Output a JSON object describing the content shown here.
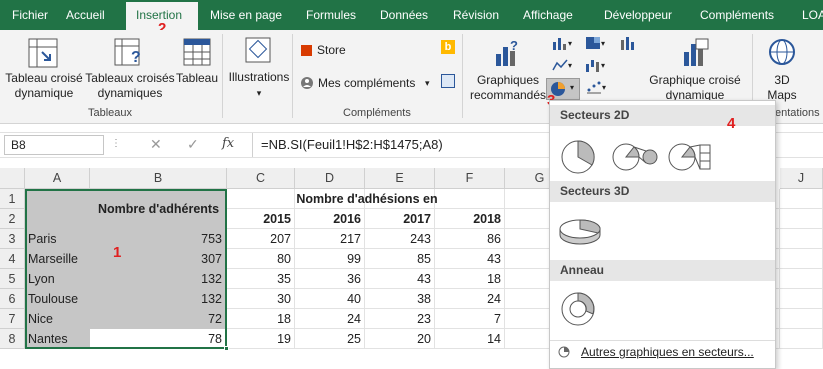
{
  "tabs": [
    "Fichier",
    "Accueil",
    "Insertion",
    "Mise en page",
    "Formules",
    "Données",
    "Révision",
    "Affichage",
    "Développeur",
    "Compléments",
    "LOA"
  ],
  "ribbon": {
    "tableau_croise": "Tableau croisé dynamique",
    "tableaux_croises": "Tableaux croisés dynamiques",
    "tableau": "Tableau",
    "group_tableaux": "Tableaux",
    "illustrations": "Illustrations",
    "store": "Store",
    "mes_complements": "Mes compléments",
    "group_complements": "Compléments",
    "graphiques_recommandes": "Graphiques recommandés",
    "graphique_croise": "Graphique croisé dynamique",
    "maps": "3D Maps",
    "group_visites": "entations"
  },
  "annotations": {
    "n1": "1",
    "n2": "2",
    "n3": "3",
    "n4": "4"
  },
  "formula": {
    "namebox": "B8",
    "fx": "fx",
    "content": "=NB.SI(Feuil1!H$2:H$1475;A8)"
  },
  "columns": [
    "A",
    "B",
    "C",
    "D",
    "E",
    "F",
    "G",
    "J"
  ],
  "rows": [
    "1",
    "2",
    "3",
    "4",
    "5",
    "6",
    "7",
    "8"
  ],
  "sheet": {
    "header_b": "Nombre d'adhérents",
    "title": "Nombre d'adhésions en",
    "years": [
      "2015",
      "2016",
      "2017",
      "2018"
    ],
    "data": [
      {
        "city": "Paris",
        "total": "753",
        "y": [
          "207",
          "217",
          "243",
          "86"
        ]
      },
      {
        "city": "Marseille",
        "total": "307",
        "y": [
          "80",
          "99",
          "85",
          "43"
        ]
      },
      {
        "city": "Lyon",
        "total": "132",
        "y": [
          "35",
          "36",
          "43",
          "18"
        ]
      },
      {
        "city": "Toulouse",
        "total": "132",
        "y": [
          "30",
          "40",
          "38",
          "24"
        ]
      },
      {
        "city": "Nice",
        "total": "72",
        "y": [
          "18",
          "24",
          "23",
          "7"
        ]
      },
      {
        "city": "Nantes",
        "total": "78",
        "y": [
          "19",
          "25",
          "20",
          "14"
        ]
      }
    ]
  },
  "dropdown": {
    "secteurs2d": "Secteurs 2D",
    "secteurs3d": "Secteurs 3D",
    "anneau": "Anneau",
    "autres": "Autres graphiques en secteurs..."
  },
  "colors": {
    "excel_green": "#217346",
    "selection": "#c6c6c6",
    "annotation_red": "#e02020"
  }
}
